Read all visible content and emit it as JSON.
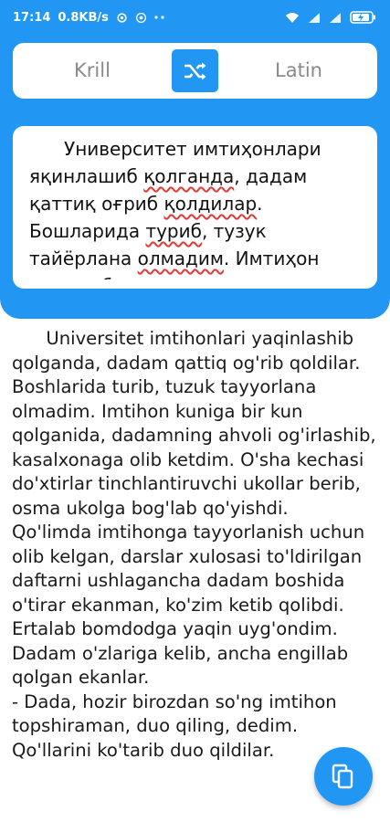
{
  "colors": {
    "primary": "#2196F3",
    "error_underline": "#e53935"
  },
  "status_bar": {
    "time": "17:14",
    "network_speed": "0.8KB/s",
    "icons": [
      "gear-icon",
      "location-icon",
      "more-icon",
      "wifi-icon",
      "signal-icon",
      "signal-icon",
      "battery-charging-icon"
    ]
  },
  "toggle": {
    "left_label": "Krill",
    "right_label": "Latin",
    "swap_icon": "shuffle-icon"
  },
  "input": {
    "segments": [
      {
        "text": "Университет имтиҳонлари яқинлашиб ",
        "error": false
      },
      {
        "text": "қолганда",
        "error": true
      },
      {
        "text": ", дадам қаттиқ оғриб ",
        "error": false
      },
      {
        "text": "қолдилар",
        "error": true
      },
      {
        "text": ". Бошларида ",
        "error": false
      },
      {
        "text": "туриб",
        "error": true
      },
      {
        "text": ", тузук тайёрлана ",
        "error": false
      },
      {
        "text": "олмадим",
        "error": true
      },
      {
        "text": ". Имтиҳон кунига бир кун қолганида",
        "error": false
      }
    ]
  },
  "output": {
    "text": "      Universitet imtihonlari yaqinlashib qolganda, dadam qattiq og'rib qoldilar. Boshlarida turib, tuzuk tayyorlana olmadim. Imtihon kuniga bir kun qolganida, dadamning ahvoli og'irlashib, kasalxonaga olib ketdim. O'sha kechasi do'xtirlar tinchlantiruvchi ukollar berib, osma ukolga bog'lab qo'yishdi.\nQo'limda imtihonga tayyorlanish uchun olib kelgan, darslar xulosasi to'ldirilgan daftarni ushlagancha dadam boshida o'tirar ekanman, ko'zim ketib qolibdi. Ertalab bomdodga yaqin uyg'ondim. Dadam o'zlariga kelib, ancha engillab qolgan ekanlar.\n- Dada, hozir birozdan so'ng imtihon topshiraman, duo qiling, dedim.\nQo'llarini ko'tarib duo qildilar."
  },
  "fab": {
    "icon": "copy-icon"
  }
}
